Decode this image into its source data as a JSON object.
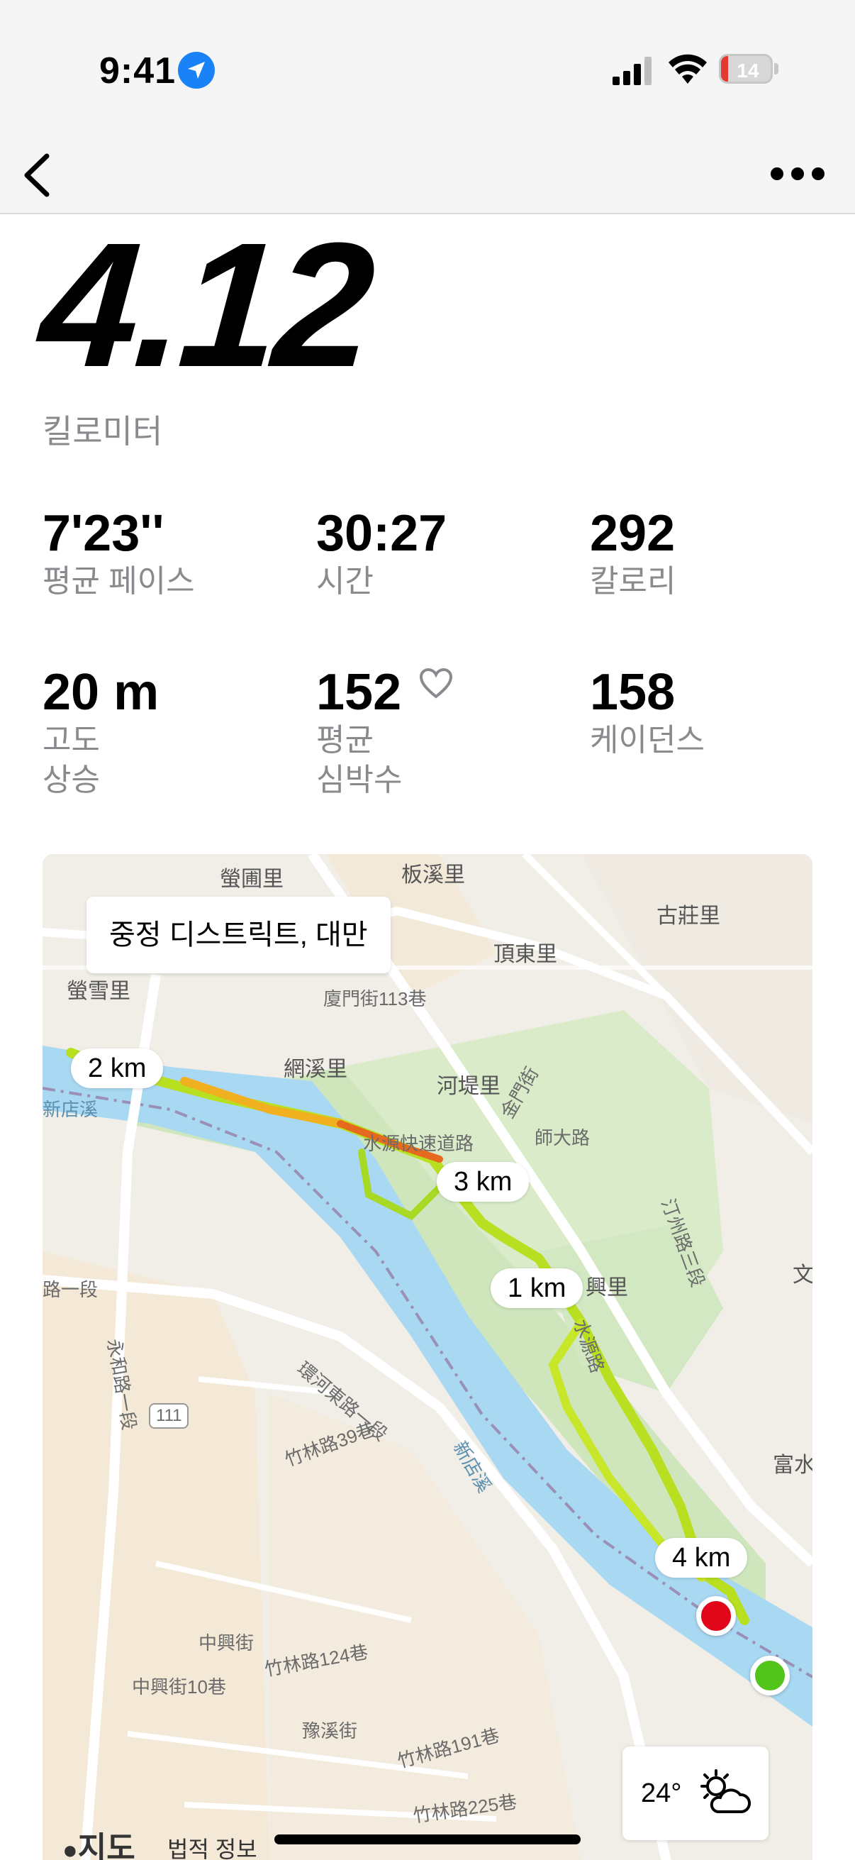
{
  "status_bar": {
    "time": "9:41",
    "battery_level": "14",
    "battery_fraction": 0.14,
    "icons": [
      "location-arrow-icon",
      "cellular-signal-icon",
      "wifi-icon",
      "battery-icon"
    ]
  },
  "nav": {
    "back_icon": "chevron-left-icon",
    "more_icon": "ellipsis-icon"
  },
  "summary": {
    "distance": "4.12",
    "unit": "킬로미터"
  },
  "stats": [
    {
      "value": "7'23''",
      "label": "평균 페이스"
    },
    {
      "value": "30:27",
      "label": "시간"
    },
    {
      "value": "292",
      "label": "칼로리"
    },
    {
      "value": "20 m",
      "label": "고도\n상승"
    },
    {
      "value": "152",
      "label": "평균\n심박수"
    },
    {
      "value": "158",
      "label": "케이던스"
    }
  ],
  "map": {
    "location": "중정 디스트릭트, 대만",
    "km_markers": [
      "2 km",
      "3 km",
      "1 km",
      "4 km"
    ],
    "weather": {
      "temp": "24°",
      "icon": "partly-cloudy-day-icon"
    },
    "brand": "지도",
    "legal": "법적 정보",
    "labels": {
      "l1": "螢圃里",
      "l2": "板溪里",
      "l3": "古莊里",
      "l4": "頂東里",
      "l5": "螢雪里",
      "l6": "廈門街113巷",
      "l7": "網溪里",
      "l8": "河堤里",
      "l9": "水源快速道路",
      "l10": "師大路",
      "l11": "興里",
      "l12": "路一段",
      "l13": "永和路一段",
      "l14": "環河東路一段",
      "l15": "新店溪",
      "l16": "竹林路39巷",
      "l17": "111",
      "l18": "富水",
      "l19": "中興街",
      "l20": "中興街10巷",
      "l21": "竹林路124巷",
      "l22": "豫溪街",
      "l23": "竹林路191巷",
      "l24": "竹林路225巷",
      "l25": "汀州路三段",
      "l26": "文",
      "l27": "新店溪",
      "l28": "金門街",
      "l29": "水源路"
    }
  }
}
